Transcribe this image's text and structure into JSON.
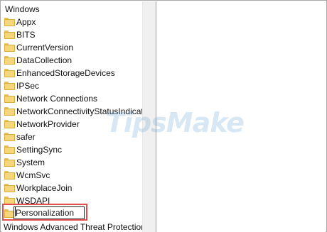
{
  "tree": {
    "parent_label": "Windows",
    "items": [
      {
        "label": "Appx"
      },
      {
        "label": "BITS"
      },
      {
        "label": "CurrentVersion"
      },
      {
        "label": "DataCollection"
      },
      {
        "label": "EnhancedStorageDevices"
      },
      {
        "label": "IPSec"
      },
      {
        "label": "Network Connections"
      },
      {
        "label": "NetworkConnectivityStatusIndicat"
      },
      {
        "label": "NetworkProvider"
      },
      {
        "label": "safer"
      },
      {
        "label": "SettingSync"
      },
      {
        "label": "System"
      },
      {
        "label": "WcmSvc"
      },
      {
        "label": "WorkplaceJoin"
      },
      {
        "label": "WSDAPI"
      }
    ],
    "editing_item": {
      "value": "Personalization"
    },
    "next_sibling_label": "Windows Advanced Threat Protection"
  },
  "watermark": "TipsMake",
  "colors": {
    "highlight_border": "#e05050",
    "folder_fill": "#f5d77a"
  }
}
